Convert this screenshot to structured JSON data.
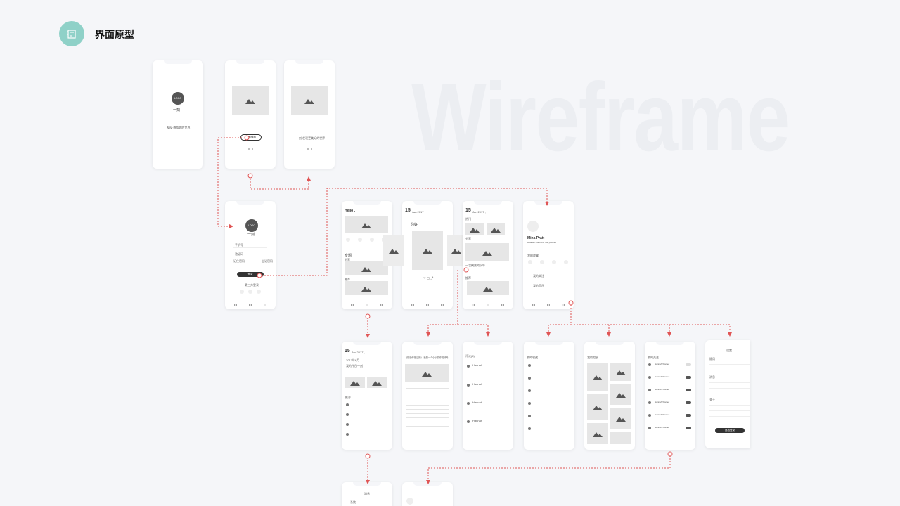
{
  "header": {
    "title": "界面原型",
    "badge_icon": "document-icon"
  },
  "watermark": "Wireframe",
  "colors": {
    "accent": "#8fd1c8",
    "flow": "#e05555",
    "background": "#f5f6f9"
  },
  "screens": {
    "splash": {
      "logo": "LOGO",
      "app_name": "一刻",
      "tagline": "发现·感悟你的世界"
    },
    "onboard2": {
      "button": "立即体验"
    },
    "onboard3": {
      "caption": "一刻 发现更美好的世界"
    },
    "login": {
      "logo": "LOGO",
      "app_name": "一刻",
      "field_phone": "手机号",
      "field_code": "验证码",
      "remember": "记住密码",
      "forgot": "忘记密码",
      "login_button": "登录",
      "third_party": "第三方登录"
    },
    "home": {
      "greeting": "Hello ,",
      "section1": "专题",
      "section2": "分享",
      "section3": "推荐"
    },
    "daily": {
      "date": "15",
      "month": "Jan 2017 ,",
      "title": "你好"
    },
    "discover": {
      "date": "15",
      "month": "Jan 2017 ,",
      "label1": "热门",
      "label2": "分享",
      "label3": "一次偶然的下午",
      "label4": "推荐"
    },
    "profile": {
      "name": "Mina Pratt",
      "subtitle": "Broaden horizons, live your life",
      "section": "我的收藏",
      "menu1": "我的关注",
      "menu2": "我的音乐"
    },
    "calendar": {
      "date": "15",
      "month": "Jan 2017 ,",
      "year_month": "2017年6月",
      "caption": "我的今日一刻",
      "section": "推荐"
    },
    "article": {
      "title": "《那些你错过的》 我是一个小小的你说好吗"
    },
    "comments": {
      "title": "评论(4)",
      "user": "Hannah"
    },
    "favorites": {
      "title": "我的收藏"
    },
    "gallery": {
      "title": "我的相册"
    },
    "notices": {
      "title": "我的关注",
      "user": "Hannah Warner"
    },
    "settings": {
      "title": "设置",
      "group1": "通用",
      "group2": "消息",
      "group3": "关于",
      "logout": "退出登录"
    },
    "calendar2": {
      "title": "消息",
      "row": "系统"
    }
  }
}
